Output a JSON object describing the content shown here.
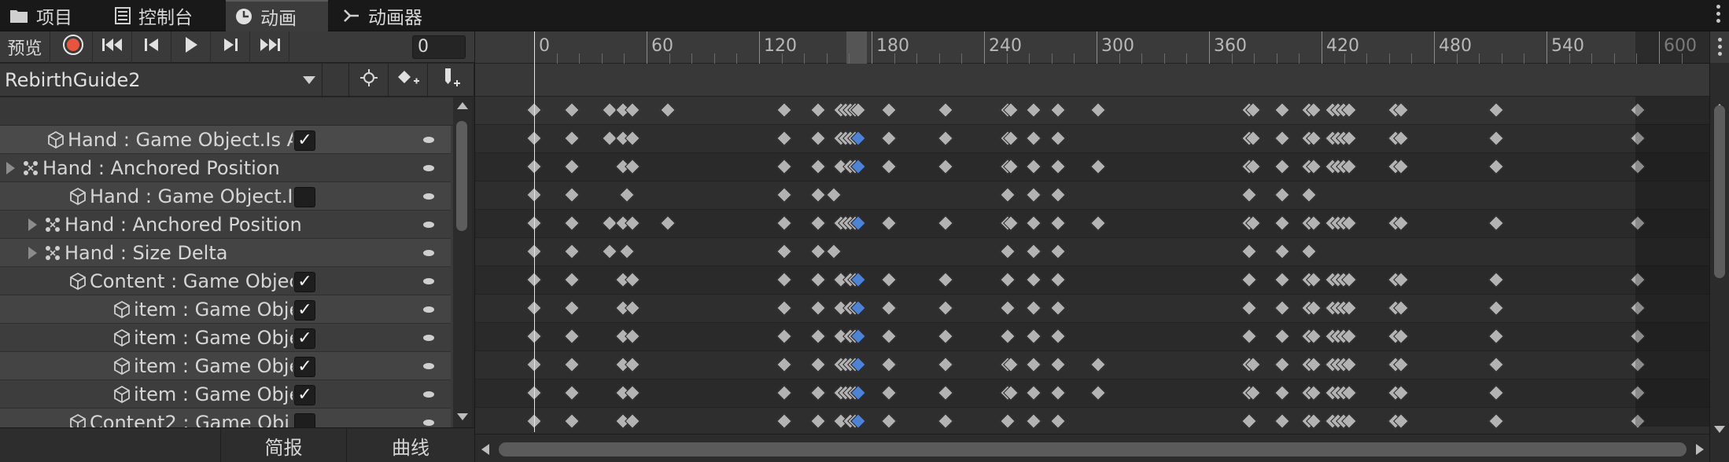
{
  "tabs": [
    {
      "label": "项目",
      "icon": "folder-icon"
    },
    {
      "label": "控制台",
      "icon": "console-icon"
    },
    {
      "label": "动画",
      "icon": "clock-icon",
      "active": true
    },
    {
      "label": "动画器",
      "icon": "animator-icon"
    }
  ],
  "toolbar": {
    "preview_label": "预览",
    "record_icon": "record-icon",
    "first_key_icon": "first-key-icon",
    "prev_key_icon": "prev-key-icon",
    "play_icon": "play-icon",
    "next_key_icon": "next-key-icon",
    "last_key_icon": "last-key-icon",
    "frame_value": "0"
  },
  "clip": {
    "name": "RebirthGuide2",
    "buttons": [
      "key-filter-icon",
      "add-keyframe-icon",
      "add-event-icon"
    ]
  },
  "properties": [
    {
      "label": "Hand : Game Object.Is A",
      "icon": "gameobject-icon",
      "checkbox": true,
      "checked": true,
      "foldable": false
    },
    {
      "label": "Hand : Anchored Position",
      "icon": "recttransform-icon",
      "checkbox": false,
      "foldable": true
    },
    {
      "label": "Hand : Game Object.I",
      "icon": "gameobject-icon",
      "checkbox": true,
      "checked": false,
      "foldable": false
    },
    {
      "label": "Hand : Anchored Position",
      "icon": "recttransform-icon",
      "checkbox": false,
      "foldable": true
    },
    {
      "label": "Hand : Size Delta",
      "icon": "recttransform-icon",
      "checkbox": false,
      "foldable": true
    },
    {
      "label": "Content : Game Objec",
      "icon": "gameobject-icon",
      "checkbox": true,
      "checked": true,
      "foldable": false
    },
    {
      "label": "item : Game Obje",
      "icon": "gameobject-icon",
      "checkbox": true,
      "checked": true,
      "foldable": false
    },
    {
      "label": "item : Game Obje",
      "icon": "gameobject-icon",
      "checkbox": true,
      "checked": true,
      "foldable": false
    },
    {
      "label": "item : Game Obje",
      "icon": "gameobject-icon",
      "checkbox": true,
      "checked": true,
      "foldable": false
    },
    {
      "label": "item : Game Obje",
      "icon": "gameobject-icon",
      "checkbox": true,
      "checked": true,
      "foldable": false
    },
    {
      "label": "Content2 : Game Obj",
      "icon": "gameobject-icon",
      "checkbox": true,
      "checked": false,
      "foldable": false
    }
  ],
  "bottom_tabs": [
    "简报",
    "曲线"
  ],
  "ruler": {
    "labels": [
      "0",
      "60",
      "120",
      "180",
      "240",
      "300",
      "360",
      "420",
      "480",
      "540",
      "600"
    ],
    "current_frame": 0
  },
  "colors": {
    "keyframe": "#b3b3b3",
    "keyframe_selected": "#4e82d6",
    "record": "#e8553f",
    "background": "#282828"
  }
}
